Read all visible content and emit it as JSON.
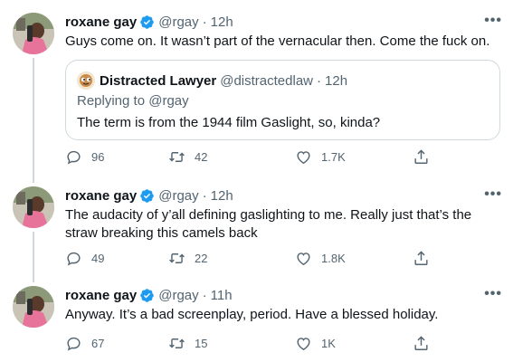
{
  "tweets": [
    {
      "name": "roxane gay",
      "handle": "@rgay",
      "time": "12h",
      "text": "Guys come on. It wasn’t part of the vernacular then. Come the fuck on.",
      "quote": {
        "name": "Distracted Lawyer",
        "handle": "@distractedlaw",
        "time": "12h",
        "replying_prefix": "Replying to",
        "replying_to": "@rgay",
        "text": "The term is from the 1944 film Gaslight, so, kinda?"
      },
      "replies": "96",
      "retweets": "42",
      "likes": "1.7K"
    },
    {
      "name": "roxane gay",
      "handle": "@rgay",
      "time": "12h",
      "text": "The audacity of y’all defining gaslighting to me. Really just that’s the straw breaking this camels back",
      "replies": "49",
      "retweets": "22",
      "likes": "1.8K"
    },
    {
      "name": "roxane gay",
      "handle": "@rgay",
      "time": "11h",
      "text": "Anyway. It’s a bad screenplay, period. Have a blessed holiday.",
      "replies": "67",
      "retweets": "15",
      "likes": "1K"
    }
  ],
  "more_label": "•••",
  "dot": "·",
  "colors": {
    "verified": "#1d9bf0",
    "secondary_text": "#536471",
    "border": "#cfd9de"
  },
  "icons": [
    "reply-icon",
    "retweet-icon",
    "like-icon",
    "share-icon",
    "verified-icon",
    "more-icon"
  ]
}
